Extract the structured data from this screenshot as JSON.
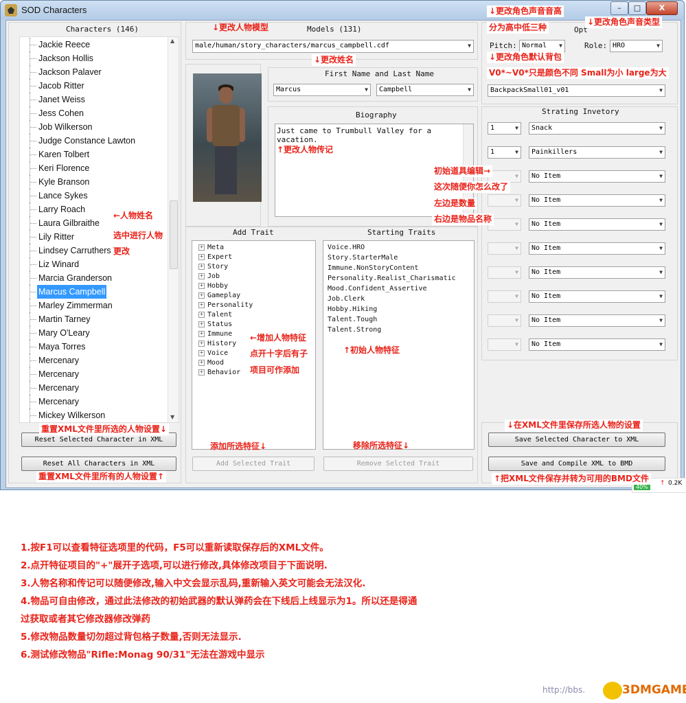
{
  "window": {
    "title": "SOD Characters",
    "btn_min": "–",
    "btn_max": "□",
    "btn_close": "X"
  },
  "characters": {
    "header": "Characters (146)",
    "items": [
      "Jackie Reece",
      "Jackson Hollis",
      "Jackson Palaver",
      "Jacob Ritter",
      "Janet Weiss",
      "Jess Cohen",
      "Job Wilkerson",
      "Judge Constance Lawton",
      "Karen Tolbert",
      "Keri Florence",
      "Kyle Branson",
      "Lance Sykes",
      "Larry Roach",
      "Laura Gilbraithe",
      "Lily Ritter",
      "Lindsey Carruthers",
      "Liz Winard",
      "Marcia Granderson",
      "Marcus Campbell",
      "Marley Zimmerman",
      "Martin Tarney",
      "Mary O'Leary",
      "Maya Torres",
      "Mercenary",
      "Mercenary",
      "Mercenary",
      "Mercenary",
      "Mickey Wilkerson"
    ],
    "selected": "Marcus Campbell",
    "reset_selected": "Reset Selected Character in XML",
    "reset_all": "Reset All Characters in XML"
  },
  "models": {
    "header": "Models (131)",
    "value": "male/human/story_characters/marcus_campbell.cdf"
  },
  "name": {
    "header": "First Name and Last Name",
    "first": "Marcus",
    "last": "Campbell"
  },
  "biography": {
    "header": "Biography",
    "text": "Just came to Trumbull Valley for a vacation."
  },
  "traits": {
    "add_header": "Add Trait",
    "add_items": [
      "Meta",
      "Expert",
      "Story",
      "Job",
      "Hobby",
      "Gameplay",
      "Personality",
      "Talent",
      "Status",
      "Immune",
      "History",
      "Voice",
      "Mood",
      "Behavior"
    ],
    "starting_header": "Starting Traits",
    "starting_items": [
      "Voice.HRO",
      "Story.StarterMale",
      "Immune.NonStoryContent",
      "Personality.Realist_Charismatic",
      "Mood.Confident_Assertive",
      "Job.Clerk",
      "Hobby.Hiking",
      "Talent.Tough",
      "Talent.Strong"
    ],
    "add_button": "Add Selected Trait",
    "remove_button": "Remove Selcted Trait"
  },
  "options": {
    "header": "Opt",
    "pitch_label": "Pitch:",
    "pitch_value": "Normal",
    "role_label": "Role:",
    "role_value": "HRO",
    "backpack": "BackpackSmall01_v01"
  },
  "inventory": {
    "header": "Strating Invetory",
    "rows": [
      {
        "qty": "1",
        "item": "Snack"
      },
      {
        "qty": "1",
        "item": "Painkillers"
      },
      {
        "qty": "",
        "item": "No Item"
      },
      {
        "qty": "",
        "item": "No Item"
      },
      {
        "qty": "",
        "item": "No Item"
      },
      {
        "qty": "",
        "item": "No Item"
      },
      {
        "qty": "",
        "item": "No Item"
      },
      {
        "qty": "",
        "item": "No Item"
      },
      {
        "qty": "",
        "item": "No Item"
      },
      {
        "qty": "",
        "item": "No Item"
      }
    ],
    "save_selected": "Save Selected Character to XML",
    "save_compile": "Save and Compile XML to BMD"
  },
  "annotations": {
    "model": "↓更改人物模型",
    "name": "↓更改姓名",
    "pitch1": "↓更改角色声音音高",
    "pitch2": "分为高中低三种",
    "role": "↓更改角色声音类型",
    "backpack1": "↓更改角色默认背包",
    "backpack2": "V0*~V0*只是颜色不同 Small为小 large为大",
    "bio": "↑更改人物传记",
    "inv1": "初始道具编辑→",
    "inv2": "这次随便你怎么改了",
    "inv3": "左边是数量",
    "inv4": "右边是物品名称",
    "names1": "←人物姓名",
    "names2": "选中进行人物",
    "names3": "更改",
    "addtrait1": "←增加人物特征",
    "addtrait2": "点开十字后有子",
    "addtrait3": "项目可作添加",
    "starttraits": "↑初始人物特征",
    "resetsel": "重置XML文件里所选的人物设置↓",
    "resetall": "重置XML文件里所有的人物设置↑",
    "addsel": "添加所选特征↓",
    "remsel": "移除所选特征↓",
    "savesel": "↓在XML文件里保存所选人物的设置",
    "savebmd": "↑把XML文件保存并转为可用的BMD文件"
  },
  "tray": {
    "percent": "40%",
    "speed": "0.2K"
  },
  "notes": [
    "1.按F1可以查看特征选项里的代码，F5可以重新读取保存后的XML文件。",
    "2.点开特征项目的\"+\"展开子选项,可以进行修改,具体修改项目于下面说明.",
    "3.人物名称和传记可以随便修改,输入中文会显示乱码,重新输入英文可能会无法汉化.",
    "4.物品可自由修改，通过此法修改的初始武器的默认弹药会在下线后上线显示为1。所以还是得通",
    "过获取或者其它修改器修改弹药",
    "5.修改物品数量切勿超过背包格子数量,否则无法显示.",
    "6.测试修改物品\"Rifle:Monag 90/31\"无法在游戏中显示"
  ],
  "watermark": {
    "url": "http://bbs.",
    "brand": "3DMGAME"
  }
}
